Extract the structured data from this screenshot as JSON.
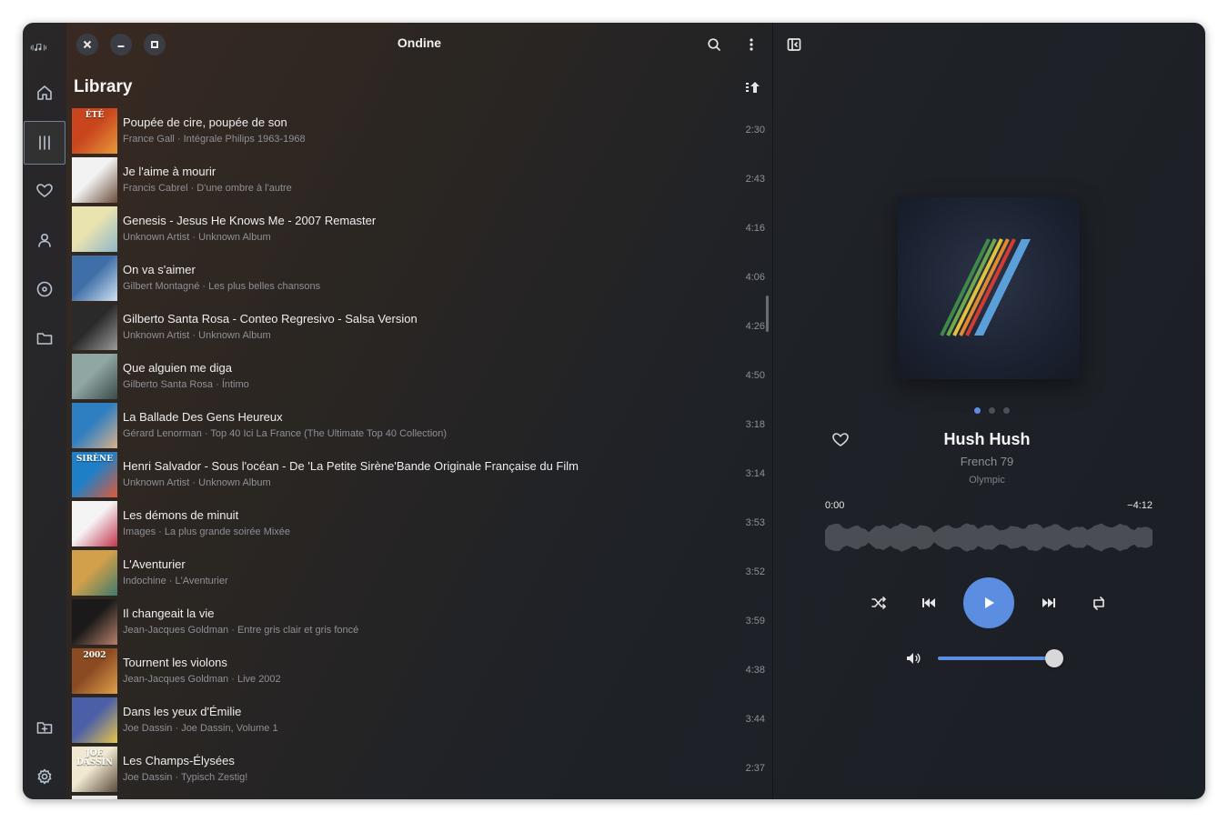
{
  "window": {
    "title": "Ondine"
  },
  "library": {
    "title": "Library",
    "tracks": [
      {
        "title": "Poupée de cire, poupée de son",
        "subtitle": "France Gall · Intégrale Philips 1963-1968",
        "duration": "2:30",
        "colors": [
          "#c8451e",
          "#e89a3a"
        ],
        "badge": "ÉTÉ"
      },
      {
        "title": "Je l'aime à mourir",
        "subtitle": "Francis Cabrel · D'une ombre à l'autre",
        "duration": "2:43",
        "colors": [
          "#f2f2f2",
          "#6b4c3a"
        ],
        "badge": ""
      },
      {
        "title": "Genesis - Jesus He Knows Me - 2007 Remaster",
        "subtitle": "Unknown Artist · Unknown Album",
        "duration": "4:16",
        "colors": [
          "#e9e3b0",
          "#8fb6c9"
        ],
        "badge": ""
      },
      {
        "title": "On va s'aimer",
        "subtitle": "Gilbert Montagné · Les plus belles chansons",
        "duration": "4:06",
        "colors": [
          "#3f6fa8",
          "#cfe1f0"
        ],
        "badge": ""
      },
      {
        "title": "Gilberto Santa Rosa - Conteo Regresivo - Salsa Version",
        "subtitle": "Unknown Artist · Unknown Album",
        "duration": "4:26",
        "colors": [
          "#2a2a2a",
          "#9a9a9a"
        ],
        "badge": ""
      },
      {
        "title": "Que alguien me diga",
        "subtitle": "Gilberto Santa Rosa · Íntimo",
        "duration": "4:50",
        "colors": [
          "#8fa6a2",
          "#3a4a48"
        ],
        "badge": ""
      },
      {
        "title": "La Ballade Des Gens Heureux",
        "subtitle": "Gérard Lenorman · Top 40 Ici La France (The Ultimate Top 40 Collection)",
        "duration": "3:18",
        "colors": [
          "#2e7fc1",
          "#d9b08a"
        ],
        "badge": ""
      },
      {
        "title": "Henri Salvador - Sous l'océan - De 'La Petite Sirène'Bande Originale Française du Film",
        "subtitle": "Unknown Artist · Unknown Album",
        "duration": "3:14",
        "colors": [
          "#1f7fc6",
          "#e05a3a"
        ],
        "badge": "SIRÈNE"
      },
      {
        "title": "Les démons de minuit",
        "subtitle": "Images · La plus grande soirée Mixée",
        "duration": "3:53",
        "colors": [
          "#f4f4f4",
          "#c4344e"
        ],
        "badge": ""
      },
      {
        "title": "L'Aventurier",
        "subtitle": "Indochine · L'Aventurier",
        "duration": "3:52",
        "colors": [
          "#d2a04a",
          "#3e7a6b"
        ],
        "badge": ""
      },
      {
        "title": "Il changeait la vie",
        "subtitle": "Jean-Jacques Goldman · Entre gris clair et gris foncé",
        "duration": "3:59",
        "colors": [
          "#1a1a1a",
          "#b9806a"
        ],
        "badge": ""
      },
      {
        "title": "Tournent les violons",
        "subtitle": "Jean-Jacques Goldman · Live 2002",
        "duration": "4:38",
        "colors": [
          "#8a4a22",
          "#e2a04a"
        ],
        "badge": "2002"
      },
      {
        "title": "Dans les yeux d'Émilie",
        "subtitle": "Joe Dassin · Joe Dassin, Volume 1",
        "duration": "3:44",
        "colors": [
          "#4a5fa8",
          "#e8c64a"
        ],
        "badge": ""
      },
      {
        "title": "Les Champs-Élysées",
        "subtitle": "Joe Dassin · Typisch Zestig!",
        "duration": "2:37",
        "colors": [
          "#f0e8d0",
          "#5a4a3a"
        ],
        "badge": "JOE DASSIN"
      },
      {
        "title": "",
        "subtitle": "",
        "duration": "",
        "colors": [
          "#e8e8e8",
          "#bbbbbb"
        ],
        "badge": ""
      }
    ]
  },
  "now_playing": {
    "title": "Hush Hush",
    "artist": "French 79",
    "album": "Olympic",
    "elapsed": "0:00",
    "remaining": "−4:12",
    "progress": 0.0,
    "volume": 0.95,
    "carousel_page": 1,
    "carousel_pages": 3
  },
  "colors": {
    "accent": "#5b8ee0"
  },
  "icons": {
    "rail": [
      "home-icon",
      "library-icon",
      "heart-icon",
      "person-icon",
      "album-icon",
      "folder-icon",
      "add-folder-icon",
      "settings-icon"
    ],
    "header": [
      "search-icon",
      "more-icon",
      "sidebar-toggle-icon"
    ],
    "controls": [
      "shuffle-icon",
      "previous-icon",
      "play-icon",
      "next-icon",
      "repeat-icon",
      "volume-icon"
    ]
  }
}
